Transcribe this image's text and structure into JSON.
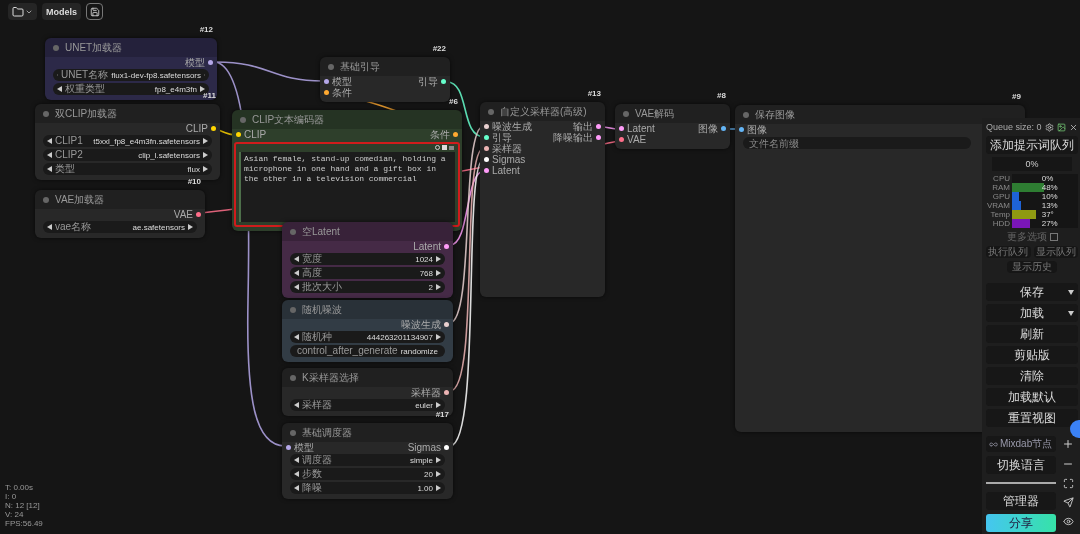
{
  "toolbar": {
    "models_button": "Models"
  },
  "nodes": [
    {
      "id": "#12",
      "title": "UNET加载器",
      "color": "#2c2948",
      "outputs": [
        {
          "label": "模型",
          "color": "#b4a7e8"
        }
      ],
      "widgets": [
        {
          "label": "UNET名称",
          "value": "flux1-dev-fp8.safetensors"
        },
        {
          "label": "权重类型",
          "value": "fp8_e4m3fn"
        }
      ]
    },
    {
      "id": "#11",
      "title": "双CLIP加载器",
      "color": "#282828",
      "outputs": [
        {
          "label": "CLIP",
          "color": "#ffd500"
        }
      ],
      "widgets": [
        {
          "label": "CLIP1",
          "value": "t5xxl_fp8_e4m3fn.safetensors"
        },
        {
          "label": "CLIP2",
          "value": "clip_l.safetensors"
        },
        {
          "label": "类型",
          "value": "flux"
        }
      ]
    },
    {
      "id": "#10",
      "title": "VAE加载器",
      "color": "#282828",
      "outputs": [
        {
          "label": "VAE",
          "color": "#ff6e8a"
        }
      ],
      "widgets": [
        {
          "label": "vae名称",
          "value": "ae.safetensors"
        }
      ]
    },
    {
      "id": "#22",
      "title": "基础引导",
      "color": "#282828",
      "inputs": [
        {
          "label": "模型",
          "color": "#b4a7e8"
        },
        {
          "label": "条件",
          "color": "#ffa931"
        }
      ],
      "outputs": [
        {
          "label": "引导",
          "color": "#66ffcc"
        }
      ]
    },
    {
      "id": "#6",
      "title": "CLIP文本编码器",
      "color": "#2e3f2b",
      "highlighted": true,
      "inputs": [
        {
          "label": "CLIP",
          "color": "#ffd500"
        }
      ],
      "outputs": [
        {
          "label": "条件",
          "color": "#ffa931"
        }
      ],
      "prompt": "Asian female, stand-up comedian, holding a microphone in one hand and a gift box in the other in a television commercial"
    },
    {
      "title": "空Latent",
      "color": "#452a46",
      "outputs": [
        {
          "label": "Latent",
          "color": "#ff9cf9"
        }
      ],
      "widgets": [
        {
          "label": "宽度",
          "value": "1024"
        },
        {
          "label": "高度",
          "value": "768"
        },
        {
          "label": "批次大小",
          "value": "2"
        }
      ]
    },
    {
      "title": "随机噪波",
      "color": "#323c45",
      "outputs": [
        {
          "label": "噪波生成",
          "color": "#e8d0d0"
        }
      ],
      "widgets": [
        {
          "label": "随机种",
          "value": "444263201134907"
        },
        {
          "label": "control_after_generate",
          "value": "randomize"
        }
      ]
    },
    {
      "title": "K采样器选择",
      "color": "#282828",
      "outputs": [
        {
          "label": "采样器",
          "color": "#ecb4b4"
        }
      ],
      "widgets": [
        {
          "label": "采样器",
          "value": "euler"
        }
      ]
    },
    {
      "id": "#17",
      "title": "基础调度器",
      "color": "#282828",
      "inputs": [
        {
          "label": "模型",
          "color": "#b4a7e8"
        }
      ],
      "outputs": [
        {
          "label": "Sigmas",
          "color": "#ffffff"
        }
      ],
      "widgets": [
        {
          "label": "调度器",
          "value": "simple"
        },
        {
          "label": "步数",
          "value": "20"
        },
        {
          "label": "降噪",
          "value": "1.00"
        }
      ]
    },
    {
      "id": "#13",
      "title": "自定义采样器(高级)",
      "color": "#282828",
      "inputs": [
        {
          "label": "噪波生成",
          "color": "#e8d0d0"
        },
        {
          "label": "引导",
          "color": "#66ffcc"
        },
        {
          "label": "采样器",
          "color": "#ecb4b4"
        },
        {
          "label": "Sigmas",
          "color": "#ffffff"
        },
        {
          "label": "Latent",
          "color": "#ff9cf9"
        }
      ],
      "outputs": [
        {
          "label": "输出",
          "color": "#ff9cf9"
        },
        {
          "label": "降噪输出",
          "color": "#ff9cf9"
        }
      ]
    },
    {
      "id": "#8",
      "title": "VAE解码",
      "color": "#282828",
      "inputs": [
        {
          "label": "Latent",
          "color": "#ff9cf9"
        },
        {
          "label": "VAE",
          "color": "#ff6e8a"
        }
      ],
      "outputs": [
        {
          "label": "图像",
          "color": "#64b5f6"
        }
      ]
    },
    {
      "id": "#9",
      "title": "保存图像",
      "color": "#282828",
      "inputs": [
        {
          "label": "图像",
          "color": "#64b5f6"
        }
      ],
      "field": {
        "placeholder": "文件名前缀"
      }
    }
  ],
  "panel": {
    "queue_size": "Queue size: 0",
    "queue_button": "添加提示词队列",
    "progress": "0%",
    "meters": [
      {
        "label": "CPU",
        "reading": "0%"
      },
      {
        "label": "RAM",
        "reading": "48%",
        "level": 0.48,
        "color": "#2e7d32"
      },
      {
        "label": "GPU",
        "reading": "10%",
        "level": 0.1,
        "color": "#1e63d6"
      },
      {
        "label": "VRAM",
        "reading": "13%",
        "level": 0.13,
        "color": "#1e63d6"
      },
      {
        "label": "Temp",
        "reading": "37°",
        "level": 0.37,
        "color": "#8f9a12"
      },
      {
        "label": "HDD",
        "reading": "27%",
        "level": 0.27,
        "color": "#7a16b8"
      }
    ],
    "more_options": {
      "label": "更多选项",
      "checked": false
    },
    "small_buttons": [
      "执行队列",
      "显示队列"
    ],
    "history_button": "显示历史",
    "buttons": [
      {
        "label": "保存",
        "dropdown": true
      },
      {
        "label": "加载",
        "dropdown": true
      },
      {
        "label": "刷新",
        "dropdown": false
      },
      {
        "label": "剪贴版",
        "dropdown": false
      },
      {
        "label": "清除",
        "dropdown": false
      },
      {
        "label": "加载默认",
        "dropdown": false
      },
      {
        "label": "重置视图",
        "dropdown": false
      }
    ],
    "mixlab_button": "Mixdab节点",
    "language_button": "切换语言",
    "manager_button": "管理器",
    "share_button": "分享"
  },
  "stats": [
    "T: 0.00s",
    "I: 0",
    "N: 12 [12]",
    "V: 24",
    "FPS:56.49"
  ]
}
